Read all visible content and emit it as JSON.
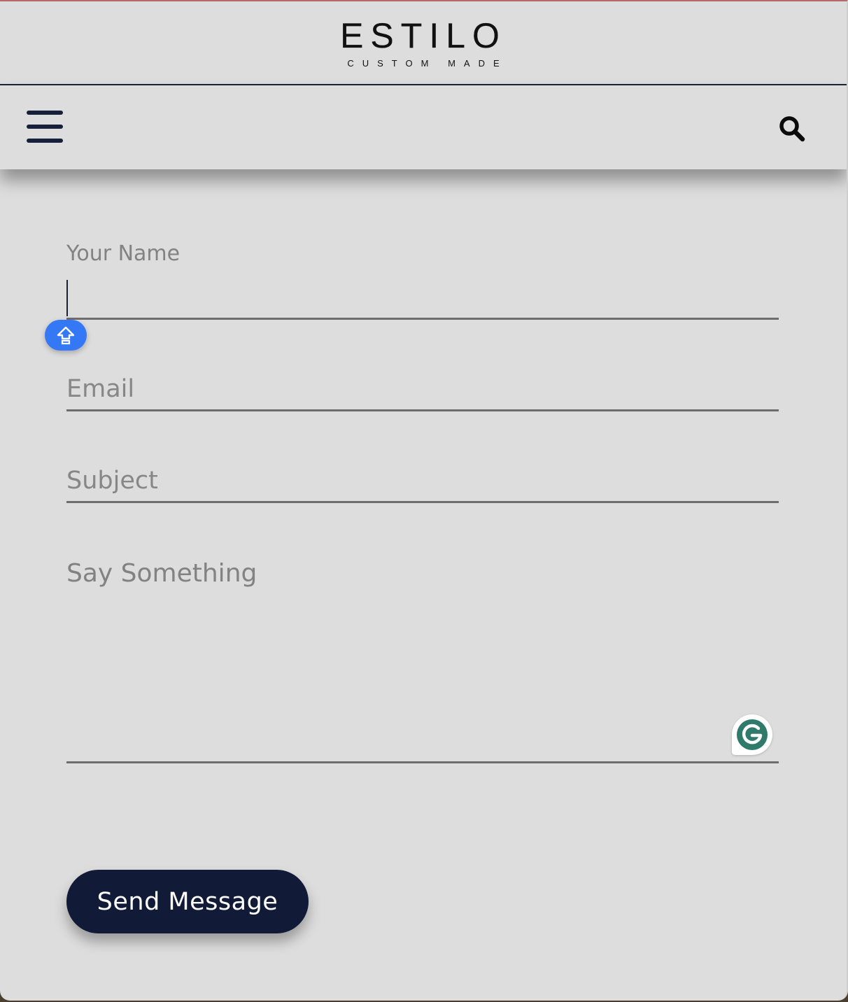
{
  "brand": {
    "name": "ESTILO",
    "tagline": "CUSTOM MADE"
  },
  "nav": {
    "menu_icon": "hamburger-menu-icon",
    "search_icon": "search-icon"
  },
  "form": {
    "name_label": "Your Name",
    "name_value": "",
    "email_placeholder": "Email",
    "subject_placeholder": "Subject",
    "message_placeholder": "Say Something",
    "submit_label": "Send Message"
  },
  "overlays": {
    "caps_lock_icon": "caps-lock-icon",
    "grammarly_icon": "grammarly-icon"
  },
  "colors": {
    "background": "#dddddd",
    "accent": "#111b38",
    "caps_badge": "#3478f6",
    "grammarly": "#2f7a6b"
  }
}
